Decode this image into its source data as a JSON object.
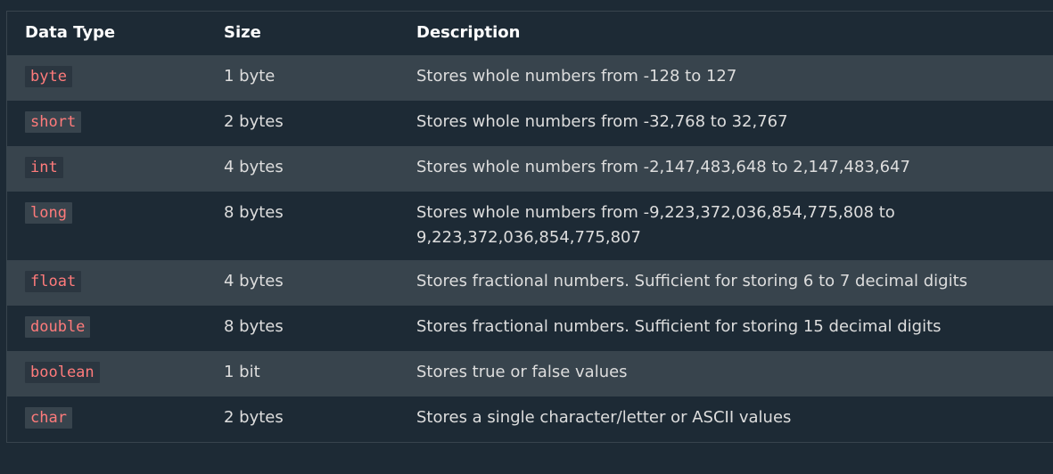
{
  "table": {
    "headers": {
      "type": "Data Type",
      "size": "Size",
      "description": "Description"
    },
    "rows": [
      {
        "type": "byte",
        "size": "1 byte",
        "description": "Stores whole numbers from -128 to 127"
      },
      {
        "type": "short",
        "size": "2 bytes",
        "description": "Stores whole numbers from -32,768 to 32,767"
      },
      {
        "type": "int",
        "size": "4 bytes",
        "description": "Stores whole numbers from -2,147,483,648 to 2,147,483,647"
      },
      {
        "type": "long",
        "size": "8 bytes",
        "description": "Stores whole numbers from -9,223,372,036,854,775,808 to 9,223,372,036,854,775,807"
      },
      {
        "type": "float",
        "size": "4 bytes",
        "description": "Stores fractional numbers. Sufficient for storing 6 to 7 decimal digits"
      },
      {
        "type": "double",
        "size": "8 bytes",
        "description": "Stores fractional numbers. Sufficient for storing 15 decimal digits"
      },
      {
        "type": "boolean",
        "size": "1 bit",
        "description": "Stores true or false values"
      },
      {
        "type": "char",
        "size": "2 bytes",
        "description": "Stores a single character/letter or ASCII values"
      }
    ]
  },
  "colors": {
    "page_background": "#1d2a35",
    "alt_row_background": "#38444d",
    "code_text": "#ff7b7b",
    "text": "#dddddd"
  }
}
